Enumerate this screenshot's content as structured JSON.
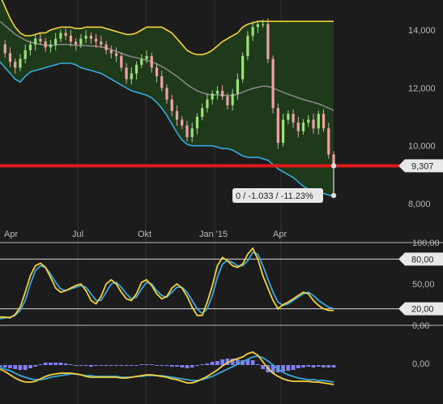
{
  "colors": {
    "background": "#1c1c1c",
    "band_fill": "#1f3a1b",
    "upper_band": "#f5d23c",
    "lower_band": "#3aa9d9",
    "middle_band": "#8a8a8a",
    "support_line": "#e01818",
    "candle_up": "#9be07a",
    "candle_down": "#f0a2a2",
    "osc_k": "#f5d23c",
    "osc_d": "#3aa9d9",
    "histogram": "#8080f0",
    "grid": "#333333"
  },
  "chart_data": [
    {
      "type": "candlestick",
      "x_tick_labels": [
        "Apr",
        "Jul",
        "Okt",
        "Jan '15",
        "Apr"
      ],
      "y_tick_labels": [
        "14,000",
        "12,000",
        "10,000",
        "8,000"
      ],
      "ylim": [
        7700,
        15000
      ],
      "horizontal_line": {
        "value": 9307,
        "label": "9,307"
      },
      "annotation": "0 / -1.033 / -11.23%",
      "annotation_value": 8280,
      "close": [
        13500,
        13200,
        12900,
        12700,
        13000,
        13300,
        13500,
        13700,
        13600,
        13400,
        13500,
        13700,
        13900,
        13800,
        13600,
        13500,
        13700,
        13800,
        13700,
        13600,
        13500,
        13300,
        13200,
        13100,
        12700,
        12300,
        12500,
        12800,
        13000,
        13100,
        12700,
        12400,
        12000,
        11600,
        11200,
        10900,
        10700,
        10300,
        10600,
        11000,
        11300,
        11600,
        11800,
        11900,
        11700,
        11400,
        11800,
        12300,
        13100,
        13800,
        14100,
        14200,
        14200,
        13000,
        11300,
        10100,
        10900,
        11100,
        10800,
        10500,
        10800,
        10900,
        10600,
        11100,
        10600,
        9700,
        9307
      ],
      "bands": {
        "upper": [
          15200,
          14800,
          14400,
          14100,
          13900,
          13800,
          13800,
          13850,
          13900,
          13900,
          14000,
          14050,
          14100,
          14100,
          14100,
          14050,
          14050,
          14100,
          14100,
          14100,
          14100,
          14050,
          14000,
          13950,
          13900,
          13850,
          13850,
          13900,
          14000,
          14100,
          14100,
          14100,
          14100,
          14000,
          13900,
          13700,
          13500,
          13300,
          13200,
          13150,
          13150,
          13200,
          13300,
          13450,
          13600,
          13700,
          13800,
          13900,
          14100,
          14200,
          14250,
          14300,
          14300,
          14300,
          14300,
          14300,
          14300,
          14300,
          14300,
          14300,
          14300,
          14300,
          14300,
          14300,
          14300,
          14300,
          14300
        ],
        "middle": [
          14300,
          14150,
          14000,
          13850,
          13750,
          13650,
          13580,
          13540,
          13500,
          13480,
          13470,
          13480,
          13500,
          13500,
          13490,
          13470,
          13460,
          13460,
          13450,
          13440,
          13420,
          13380,
          13330,
          13260,
          13200,
          13130,
          13080,
          13040,
          13000,
          12960,
          12900,
          12830,
          12740,
          12640,
          12520,
          12400,
          12260,
          12120,
          12000,
          11900,
          11830,
          11780,
          11760,
          11760,
          11750,
          11730,
          11740,
          11780,
          11850,
          11920,
          11980,
          12020,
          12060,
          12050,
          12000,
          11920,
          11850,
          11780,
          11720,
          11660,
          11600,
          11550,
          11500,
          11450,
          11380,
          11300,
          11220
        ],
        "lower": [
          12900,
          12700,
          12500,
          12300,
          12200,
          12400,
          12550,
          12600,
          12650,
          12700,
          12750,
          12800,
          12850,
          12850,
          12850,
          12800,
          12700,
          12650,
          12600,
          12550,
          12500,
          12400,
          12300,
          12200,
          12100,
          12000,
          11900,
          11850,
          11800,
          11750,
          11650,
          11500,
          11300,
          11050,
          10750,
          10450,
          10200,
          10050,
          10000,
          10000,
          10000,
          10000,
          10000,
          9950,
          9900,
          9900,
          9850,
          9750,
          9650,
          9600,
          9600,
          9600,
          9550,
          9500,
          9350,
          9200,
          9100,
          9000,
          8900,
          8750,
          8600,
          8500,
          8450,
          8400,
          8350,
          8300,
          8250
        ]
      }
    },
    {
      "type": "line",
      "y_tick_labels": [
        "100,00",
        "80,00",
        "50,00",
        "20,00",
        "0,00"
      ],
      "level_tags": [
        "80,00",
        "20,00"
      ],
      "ylim": [
        0,
        100
      ],
      "series": [
        {
          "values": [
            10,
            10,
            9,
            13,
            22,
            40,
            60,
            72,
            75,
            70,
            58,
            45,
            40,
            42,
            45,
            48,
            50,
            42,
            30,
            26,
            35,
            50,
            55,
            50,
            40,
            32,
            30,
            38,
            52,
            55,
            48,
            38,
            32,
            35,
            45,
            50,
            45,
            35,
            22,
            12,
            12,
            28,
            48,
            72,
            82,
            78,
            72,
            70,
            74,
            86,
            93,
            80,
            60,
            45,
            30,
            20,
            25,
            28,
            32,
            36,
            40,
            38,
            30,
            24,
            20,
            18,
            18
          ]
        },
        {
          "values": [
            8,
            9,
            10,
            12,
            18,
            30,
            50,
            66,
            72,
            70,
            62,
            52,
            44,
            42,
            44,
            46,
            48,
            46,
            38,
            30,
            30,
            40,
            50,
            52,
            46,
            38,
            32,
            34,
            44,
            52,
            50,
            42,
            36,
            34,
            40,
            46,
            46,
            40,
            30,
            20,
            14,
            20,
            36,
            58,
            74,
            78,
            76,
            72,
            72,
            78,
            88,
            86,
            72,
            56,
            40,
            28,
            24,
            26,
            30,
            34,
            38,
            40,
            36,
            30,
            26,
            22,
            20
          ]
        }
      ]
    },
    {
      "type": "line",
      "y_tick_labels": [
        "0,00"
      ],
      "series": [
        {
          "values": [
            -5,
            -8,
            -12,
            -16,
            -19,
            -21,
            -21,
            -20,
            -17,
            -14,
            -12,
            -11,
            -10,
            -10,
            -10,
            -11,
            -12,
            -14,
            -15,
            -15,
            -15,
            -15,
            -15,
            -15,
            -16,
            -16,
            -15,
            -14,
            -13,
            -12,
            -12,
            -13,
            -14,
            -15,
            -17,
            -18,
            -20,
            -22,
            -22,
            -20,
            -17,
            -14,
            -10,
            -6,
            -1,
            3,
            6,
            8,
            10,
            14,
            16,
            12,
            4,
            -4,
            -10,
            -14,
            -17,
            -19,
            -20,
            -20,
            -20,
            -20,
            -21,
            -21,
            -22,
            -23,
            -24
          ]
        },
        {
          "values": [
            -3,
            -5,
            -7,
            -10,
            -13,
            -15,
            -17,
            -18,
            -18,
            -17,
            -15,
            -14,
            -13,
            -12,
            -11,
            -11,
            -12,
            -13,
            -13,
            -14,
            -14,
            -14,
            -14,
            -14,
            -15,
            -15,
            -15,
            -14,
            -14,
            -13,
            -13,
            -13,
            -13,
            -14,
            -15,
            -16,
            -17,
            -18,
            -19,
            -19,
            -18,
            -16,
            -14,
            -11,
            -8,
            -5,
            -2,
            1,
            4,
            7,
            10,
            11,
            9,
            5,
            0,
            -5,
            -9,
            -12,
            -14,
            -16,
            -17,
            -18,
            -18,
            -19,
            -19,
            -20,
            -21
          ]
        },
        {
          "values": [
            -2,
            -3,
            -4,
            -5,
            -6,
            -6,
            -4,
            -2,
            1,
            3,
            3,
            3,
            3,
            2,
            1,
            0,
            0,
            -1,
            -2,
            -1,
            -1,
            -1,
            -1,
            -1,
            -1,
            -1,
            0,
            0,
            1,
            1,
            1,
            0,
            -1,
            -1,
            -2,
            -2,
            -3,
            -4,
            -3,
            -1,
            1,
            2,
            4,
            5,
            7,
            8,
            8,
            7,
            6,
            7,
            6,
            1,
            -5,
            -9,
            -10,
            -9,
            -8,
            -7,
            -6,
            -4,
            -3,
            -2,
            -3,
            -2,
            -3,
            -3,
            -3
          ]
        }
      ]
    }
  ]
}
